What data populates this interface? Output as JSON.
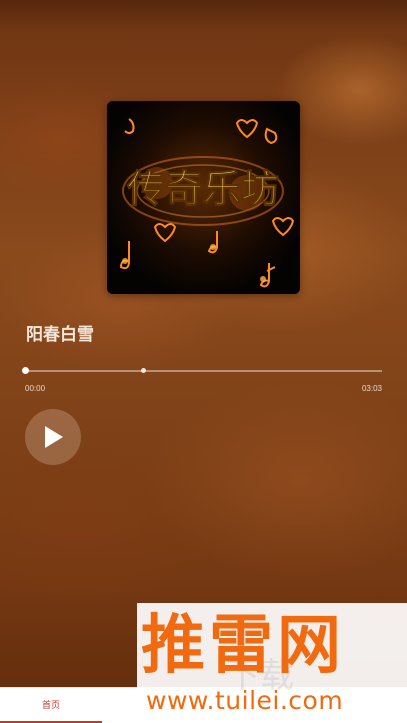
{
  "player": {
    "album_art_title": "传奇乐坊",
    "song_title": "阳春白雪",
    "current_time": "00:00",
    "total_time": "03:03",
    "progress_fraction": 0.0,
    "buffered_fraction": 0.33
  },
  "tabs": [
    {
      "label": "首页",
      "active": true
    },
    {
      "label": "",
      "active": false
    }
  ],
  "watermark": {
    "brand": "推雷网",
    "url": "www.tuilei.com",
    "ghost_text": "下载"
  },
  "colors": {
    "accent": "#c0392b",
    "watermark": "#f26a10"
  }
}
